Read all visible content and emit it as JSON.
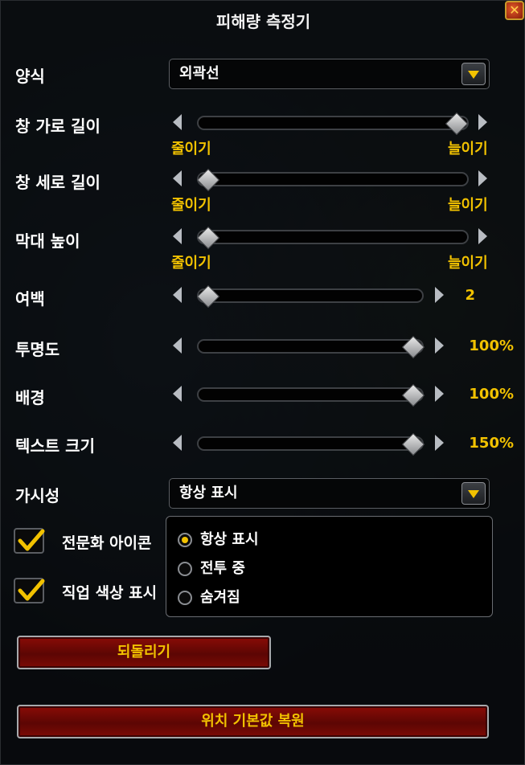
{
  "window": {
    "title": "피해량 측정기"
  },
  "style_row": {
    "label": "양식",
    "selected": "외곽선"
  },
  "window_width": {
    "label": "창 가로 길이",
    "min_label": "줄이기",
    "max_label": "늘이기",
    "level": 0.95
  },
  "window_height": {
    "label": "창 세로 길이",
    "min_label": "줄이기",
    "max_label": "늘이기",
    "level": 0.05
  },
  "bar_height": {
    "label": "막대 높이",
    "min_label": "줄이기",
    "max_label": "늘이기",
    "level": 0.05
  },
  "margin": {
    "label": "여백",
    "value": "2",
    "level": 0.05
  },
  "opacity": {
    "label": "투명도",
    "value": "100%",
    "level": 1.0
  },
  "background": {
    "label": "배경",
    "value": "100%",
    "level": 1.0
  },
  "text_size": {
    "label": "텍스트 크기",
    "value": "150%",
    "level": 1.0
  },
  "visibility": {
    "label": "가시성",
    "selected": "항상 표시",
    "options": [
      "항상 표시",
      "전투 중",
      "숨겨짐"
    ]
  },
  "checkboxes": [
    {
      "label": "전문화 아이콘",
      "checked": true
    },
    {
      "label": "직업 색상 표시",
      "checked": true
    }
  ],
  "buttons": {
    "reset": "되돌리기",
    "reset_position": "위치 기본값 복원"
  },
  "colors": {
    "accent": "#f2c200",
    "button_red": "#7a0805",
    "panel": "#08090b"
  }
}
